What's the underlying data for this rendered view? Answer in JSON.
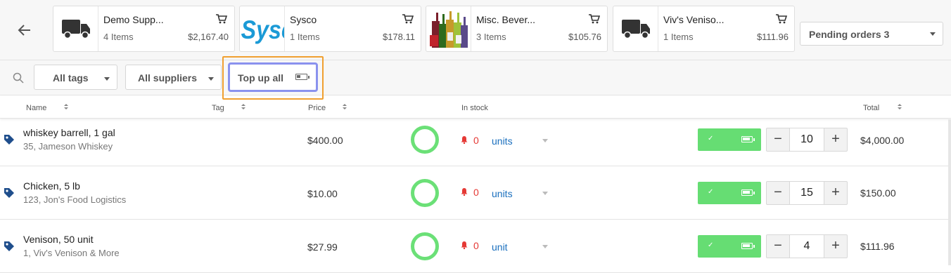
{
  "header": {
    "suppliers": [
      {
        "name": "Demo Supp...",
        "items": "4 Items",
        "amount": "$2,167.40",
        "logo": "truck-icon"
      },
      {
        "name": "Sysco",
        "items": "1 Items",
        "amount": "$178.11",
        "logo": "sysco-logo",
        "logo_text": "Sysco"
      },
      {
        "name": "Misc. Bever...",
        "items": "3 Items",
        "amount": "$105.76",
        "logo": "bottles-image"
      },
      {
        "name": "Viv's Veniso...",
        "items": "1 Items",
        "amount": "$111.96",
        "logo": "truck-icon"
      }
    ],
    "pending_orders": "Pending orders 3"
  },
  "filters": {
    "tags": "All tags",
    "suppliers": "All suppliers",
    "top_up": "Top up all"
  },
  "columns": {
    "name": "Name",
    "tag": "Tag",
    "price": "Price",
    "in_stock": "In stock",
    "total": "Total"
  },
  "rows": [
    {
      "name": "whiskey barrell, 1 gal",
      "sub": "35, Jameson Whiskey",
      "price": "$400.00",
      "stock": "0",
      "unit": "units",
      "qty": "10",
      "total": "$4,000.00"
    },
    {
      "name": "Chicken, 5 lb",
      "sub": "123, Jon's Food Logistics",
      "price": "$10.00",
      "stock": "0",
      "unit": "units",
      "qty": "15",
      "total": "$150.00"
    },
    {
      "name": "Venison, 50 unit",
      "sub": "1, Viv's Venison & More",
      "price": "$27.99",
      "stock": "0",
      "unit": "unit",
      "qty": "4",
      "total": "$111.96"
    }
  ],
  "colors": {
    "accent_green": "#66dd73",
    "ring_green": "#6be077",
    "alert_red": "#e53935",
    "link_blue": "#1a6fbe",
    "focus_outline": "#f0a030",
    "focus_ring": "#8a92ee",
    "tag_icon": "#1f4e8c"
  },
  "plus_symbol": "+",
  "minus_symbol": "−"
}
